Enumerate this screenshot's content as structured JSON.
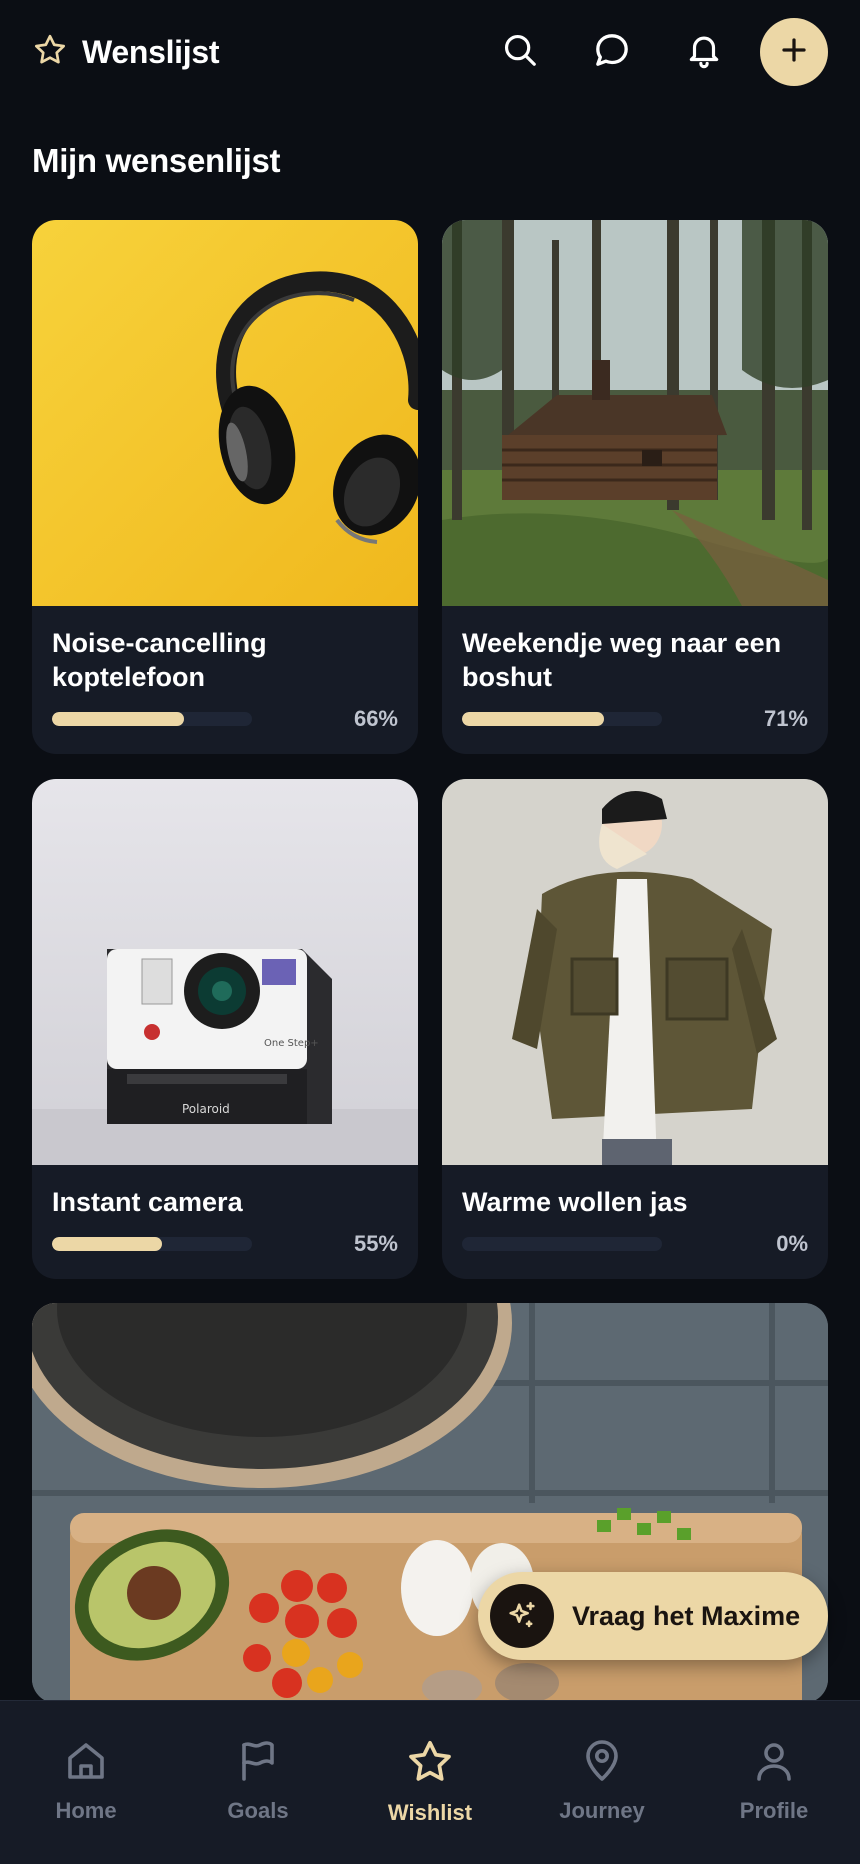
{
  "header": {
    "title": "Wenslijst",
    "icons": [
      "star-icon",
      "search-icon",
      "chat-icon",
      "bell-icon",
      "plus-icon"
    ]
  },
  "section_title": "Mijn wensenlijst",
  "wishlist": [
    {
      "name": "Noise-cancelling koptelefoon",
      "progress": 0.66,
      "progress_label": "66%",
      "image": "headphones-photo"
    },
    {
      "name": "Weekendje weg naar een boshut",
      "progress": 0.71,
      "progress_label": "71%",
      "image": "cabin-photo"
    },
    {
      "name": "Instant camera",
      "progress": 0.55,
      "progress_label": "55%",
      "image": "polaroid-camera-photo"
    },
    {
      "name": "Warme wollen jas",
      "progress": 0.0,
      "progress_label": "0%",
      "image": "woman-in-jacket-photo"
    }
  ],
  "camera_print": {
    "brand": "Polaroid",
    "model": "One Step+"
  },
  "assistant": {
    "label": "Vraag het Maxime"
  },
  "nav": {
    "items": [
      {
        "label": "Home",
        "icon": "home-icon"
      },
      {
        "label": "Goals",
        "icon": "flag-icon"
      },
      {
        "label": "Wishlist",
        "icon": "star-icon"
      },
      {
        "label": "Journey",
        "icon": "map-pin-icon"
      },
      {
        "label": "Profile",
        "icon": "user-icon"
      }
    ],
    "active": "Wishlist"
  },
  "colors": {
    "background": "#0b0e14",
    "card": "#161b26",
    "accent": "#ecd7a6",
    "muted": "#6f7686"
  }
}
